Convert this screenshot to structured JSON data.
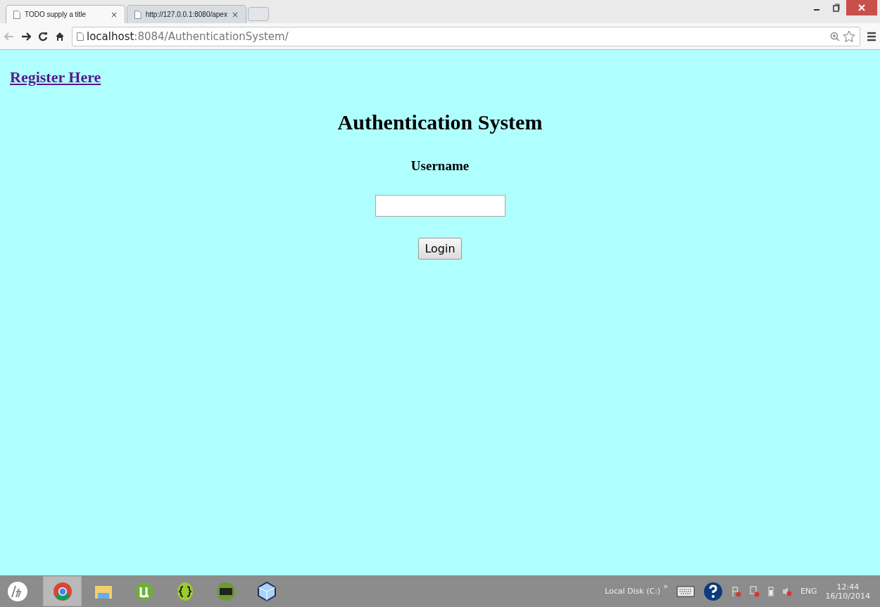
{
  "browser": {
    "tabs": [
      {
        "title": "TODO supply a title",
        "selected": true
      },
      {
        "title": "http://127.0.0.1:8080/apex",
        "selected": false
      }
    ],
    "close_glyph": "×",
    "url_host": "localhost",
    "url_path": ":8084/AuthenticationSystem/"
  },
  "page": {
    "link": "Register Here",
    "heading": "Authentication System",
    "label": "Username",
    "button": "Login"
  },
  "taskbar": {
    "apps": [
      {
        "kind": "chrome",
        "selected": true
      },
      {
        "kind": "folder",
        "selected": false
      },
      {
        "kind": "torrent",
        "selected": false
      },
      {
        "kind": "braces",
        "selected": false
      },
      {
        "kind": "terminal",
        "selected": false
      },
      {
        "kind": "cube",
        "selected": false
      }
    ],
    "drive_label": "Local Disk (C:)",
    "chevron": "»",
    "language": "ENG",
    "time": "12:44",
    "date": "16/10/2014"
  }
}
